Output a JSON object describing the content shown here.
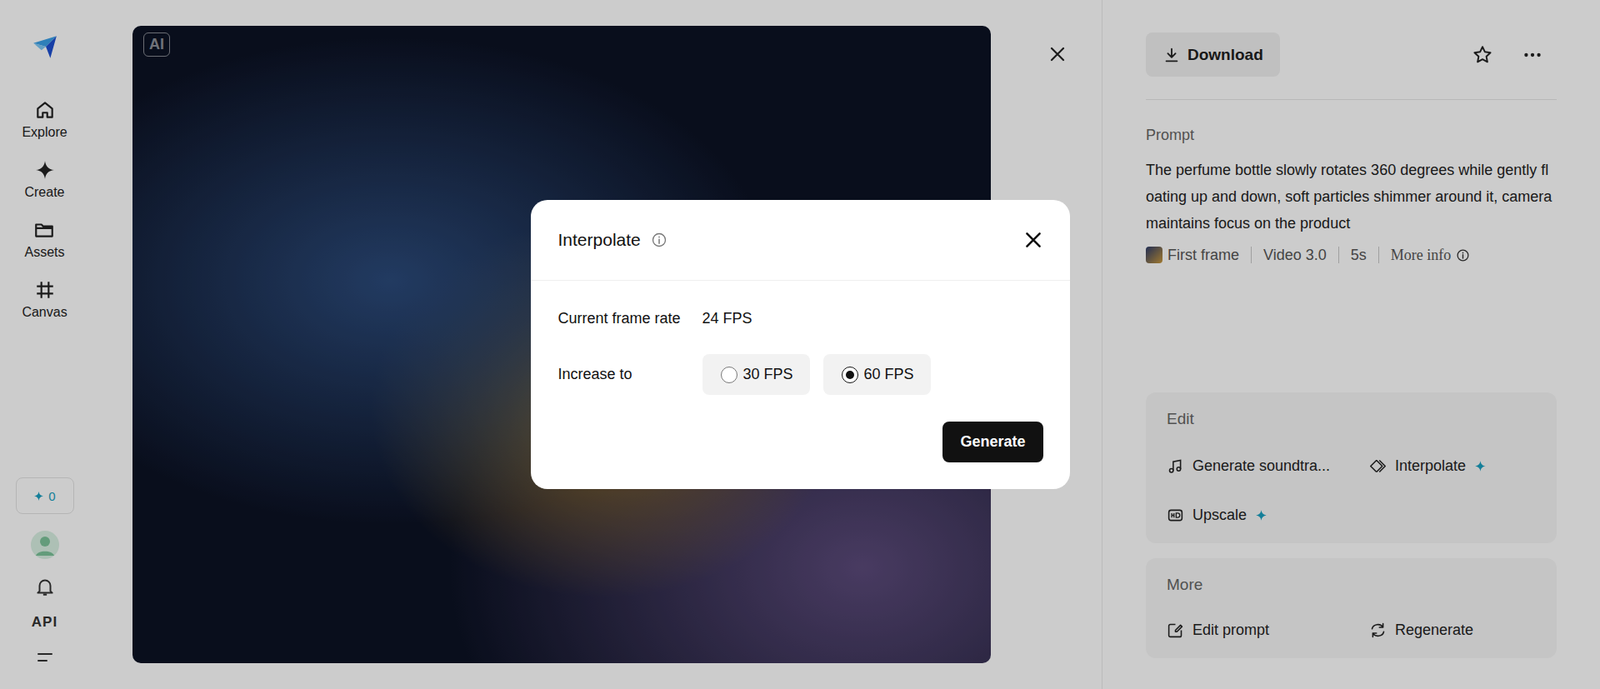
{
  "sidebar": {
    "items": [
      {
        "label": "Explore",
        "selected": false
      },
      {
        "label": "Create",
        "selected": false
      },
      {
        "label": "Assets",
        "selected": false
      },
      {
        "label": "Canvas",
        "selected": false
      }
    ],
    "credits": "0",
    "api": "API"
  },
  "viewer": {
    "badge": "AI"
  },
  "panel": {
    "download": "Download",
    "prompt_label": "Prompt",
    "prompt": "The perfume bottle slowly rotates 360 degrees while gently floating up and down, soft particles shimmer around it, camera maintains focus on the product",
    "meta": [
      "First frame",
      "Video 3.0",
      "5s"
    ],
    "more_info": "More info",
    "edit": {
      "title": "Edit",
      "actions": [
        {
          "label": "Generate soundtra...",
          "premium": false
        },
        {
          "label": "Interpolate",
          "premium": true
        },
        {
          "label": "Upscale",
          "premium": true
        }
      ]
    },
    "more": {
      "title": "More",
      "actions": [
        "Edit prompt",
        "Regenerate"
      ]
    }
  },
  "dialog": {
    "title": "Interpolate",
    "current_label": "Current frame rate",
    "current_value": "24 FPS",
    "increase_label": "Increase to",
    "options": [
      {
        "label": "30 FPS",
        "selected": false
      },
      {
        "label": "60 FPS",
        "selected": true
      }
    ],
    "button": "Generate"
  }
}
